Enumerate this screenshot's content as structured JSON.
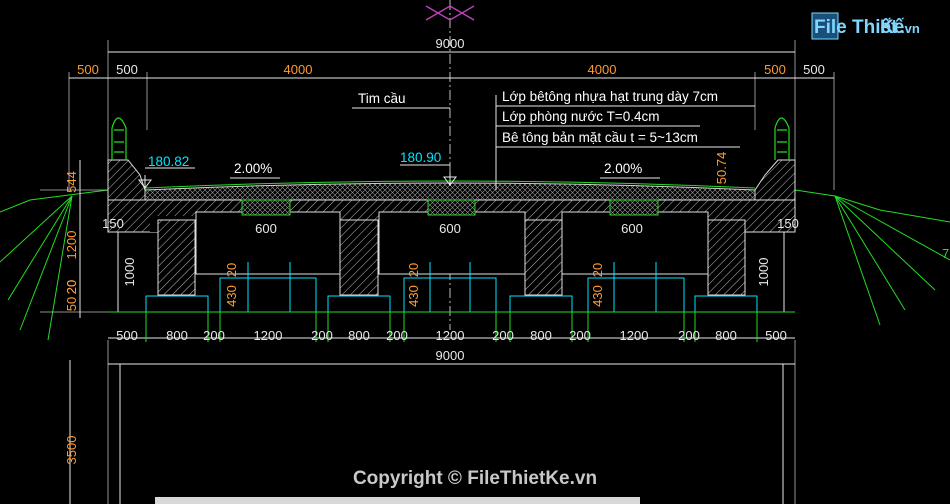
{
  "logo": {
    "brand_file": "File",
    "brand_thiet": "Thiết",
    "brand_ke": "Kế",
    "brand_vn": ".vn"
  },
  "copyright": "Copyright © FileThietKe.vn",
  "dims": {
    "total_top": "9000",
    "edge_top_left_outer": "500",
    "edge_top_left_inner": "500",
    "half_left": "4000",
    "half_right": "4000",
    "edge_top_right_inner": "500",
    "edge_top_right_outer": "500",
    "left_h1": "544",
    "left_h2": "1200",
    "left_h3": "20",
    "left_h4": "50",
    "left_h5": "20",
    "inner_left_150": "150",
    "inner_right_150": "150",
    "web_left_1000": "1000",
    "web_right_1000": "1000",
    "haunch_50_74": "50.74",
    "slot_600_1": "600",
    "slot_600_2": "600",
    "slot_600_3": "600",
    "r20_1": "20",
    "r20_2": "20",
    "r20_3": "20",
    "r430_1": "430",
    "r430_2": "430",
    "r430_3": "430",
    "bottom": [
      "500",
      "800",
      "200",
      "1200",
      "200",
      "800",
      "200",
      "1200",
      "200",
      "800",
      "200",
      "1200",
      "200",
      "800",
      "500"
    ],
    "total_bottom": "9000",
    "pier_3500": "3500"
  },
  "labels": {
    "tim_cau": "Tim cầu",
    "layer1": "Lớp bêtông nhựa hạt trung dày 7cm",
    "layer2": "Lớp phòng nước T=0.4cm",
    "layer3": "Bê tông bản mặt cầu  t = 5~13cm",
    "slope_left": "2.00%",
    "slope_right": "2.00%",
    "elev_left": "180.82",
    "elev_center": "180.90",
    "edge_right_fragment": "7"
  }
}
